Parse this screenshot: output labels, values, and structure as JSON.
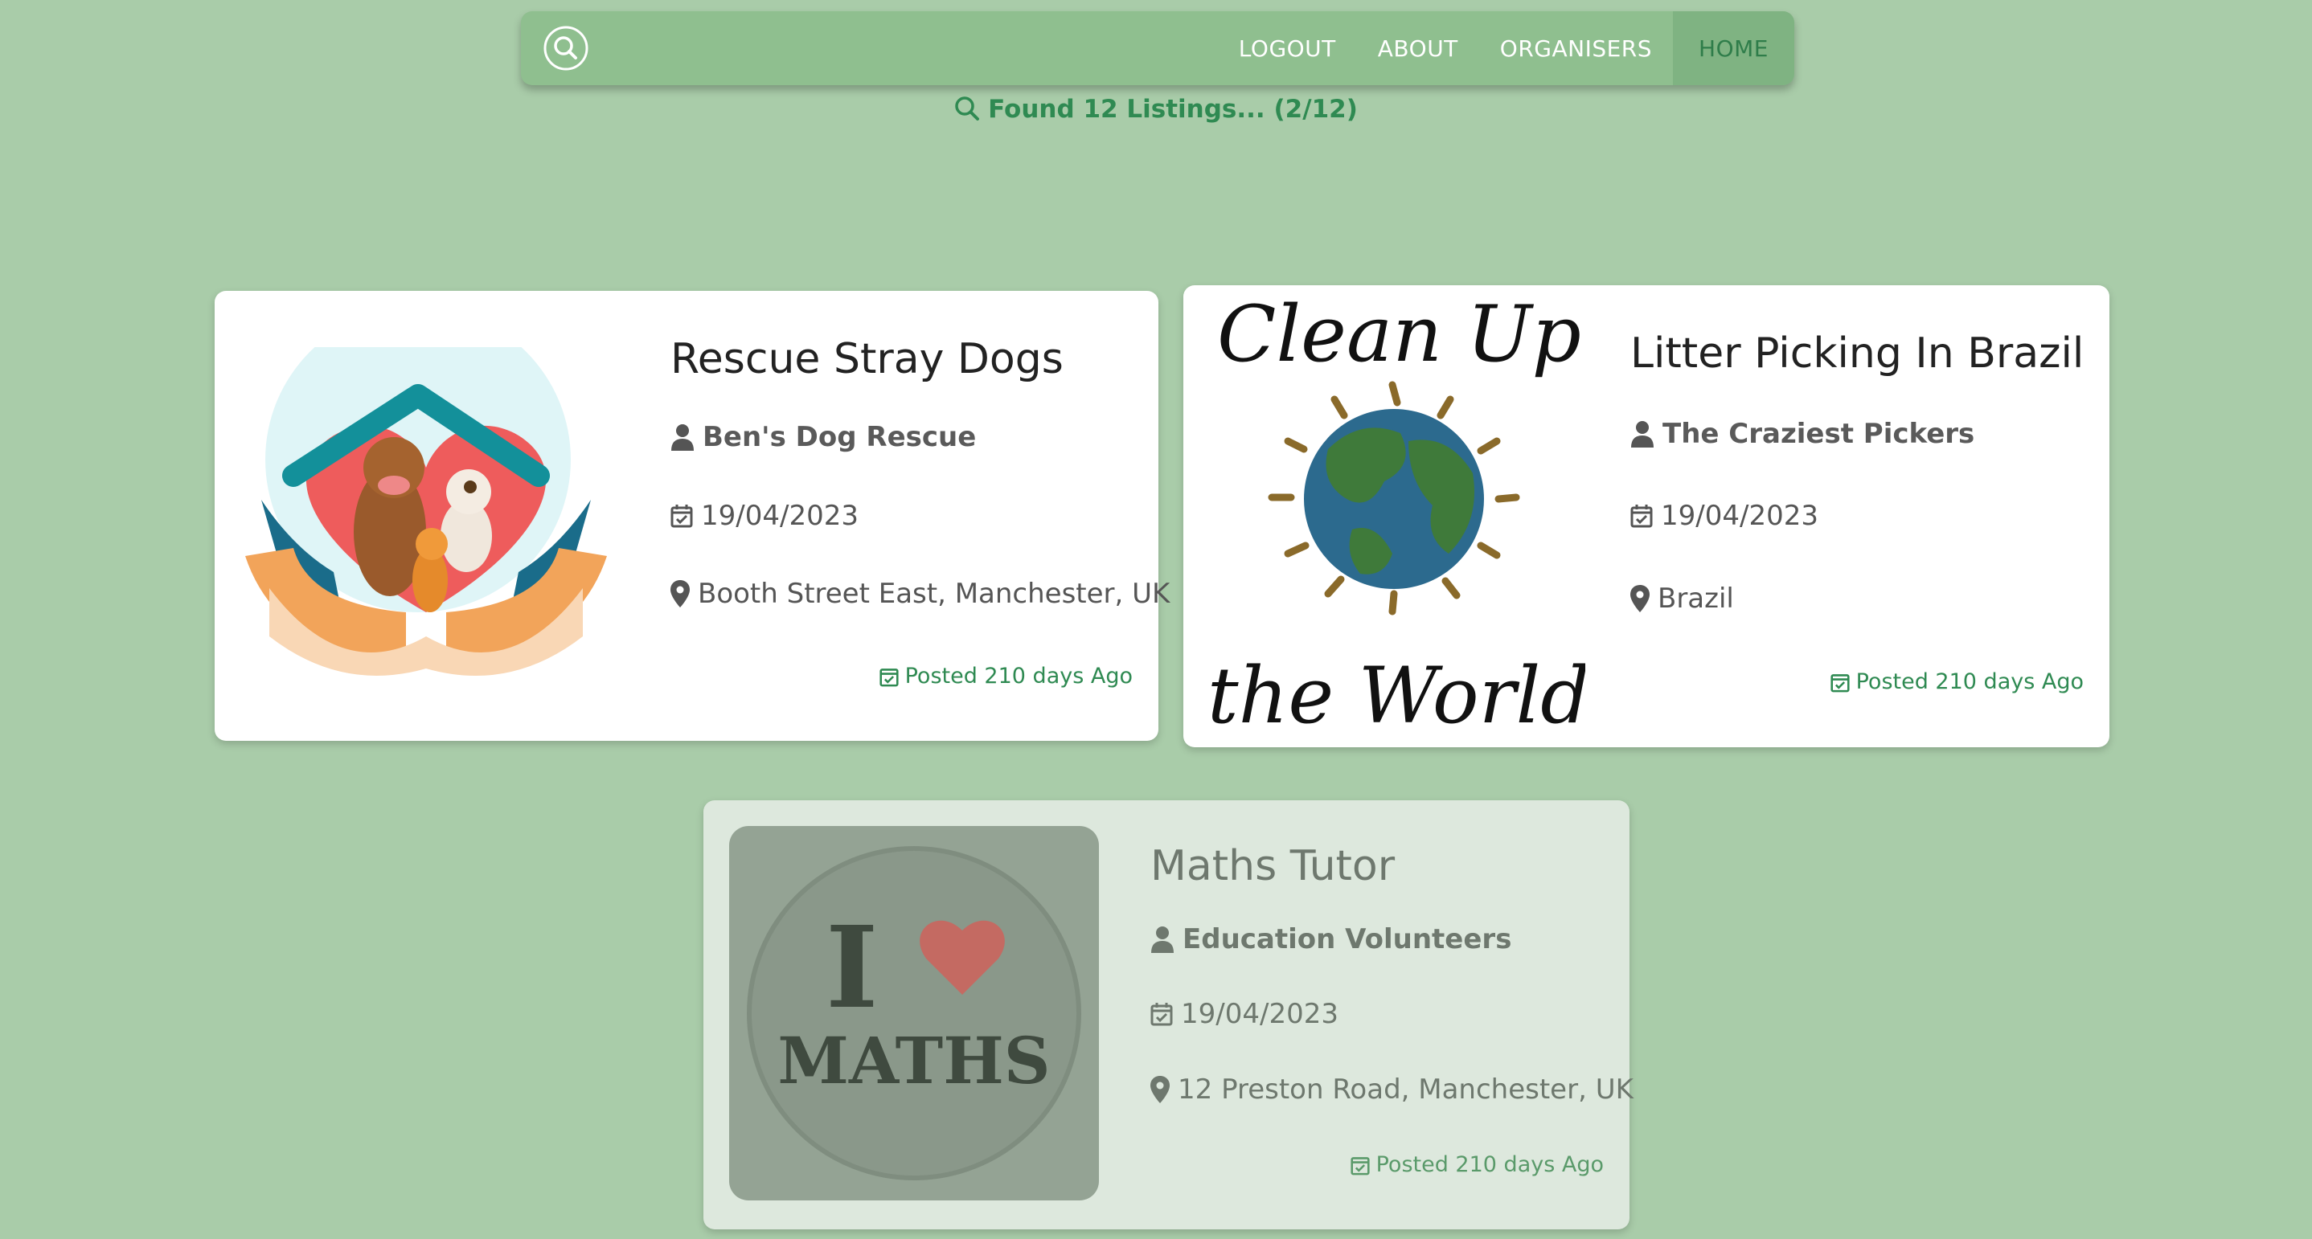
{
  "nav": {
    "search_icon": "search-circle-icon",
    "links": [
      "LOGOUT",
      "ABOUT",
      "ORGANISERS",
      "HOME"
    ],
    "active": "HOME"
  },
  "results": {
    "text": "Found 12 Listings... (2/12)"
  },
  "listings": [
    {
      "title": "Rescue Stray Dogs",
      "organiser": "Ben's Dog Rescue",
      "date": "19/04/2023",
      "location": "Booth Street East, Manchester, UK",
      "posted": "Posted 210 days Ago",
      "image": "dogs-in-hands-illustration"
    },
    {
      "title": "Litter Picking In Brazil",
      "organiser": "The Craziest Pickers",
      "date": "19/04/2023",
      "location": "Brazil",
      "posted": "Posted 210 days Ago",
      "image": "clean-up-the-world-drawing",
      "image_text_top": "Clean Up",
      "image_text_bottom": "the World"
    },
    {
      "title": "Maths Tutor",
      "organiser": "Education Volunteers",
      "date": "19/04/2023",
      "location": "12 Preston Road, Manchester, UK",
      "posted": "Posted 210 days Ago",
      "image": "i-love-maths-badge",
      "image_text_top": "I",
      "image_text_bottom": "MATHS"
    }
  ],
  "colors": {
    "background": "#a9cca9",
    "navbar": "#8fbf8f",
    "accent": "#2f8a52"
  }
}
